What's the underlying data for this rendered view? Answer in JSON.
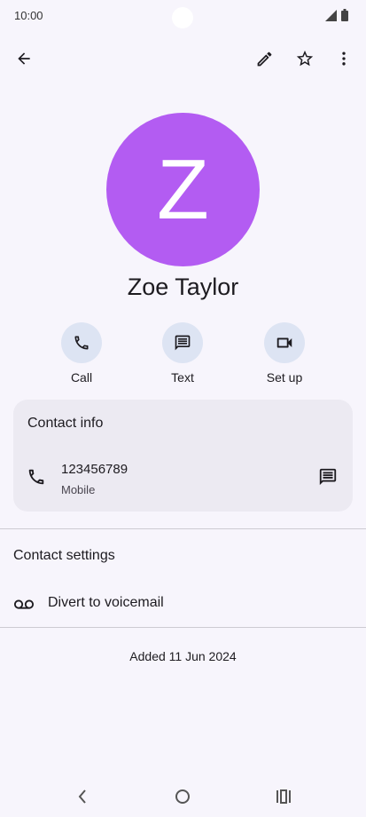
{
  "status_bar": {
    "time": "10:00"
  },
  "contact": {
    "initial": "Z",
    "name": "Zoe Taylor",
    "avatar_color": "#b35cf2"
  },
  "actions": [
    {
      "label": "Call",
      "icon": "phone-icon"
    },
    {
      "label": "Text",
      "icon": "message-icon"
    },
    {
      "label": "Set up",
      "icon": "video-icon"
    }
  ],
  "contact_info": {
    "title": "Contact info",
    "phone": {
      "number": "123456789",
      "type": "Mobile"
    }
  },
  "contact_settings": {
    "title": "Contact settings",
    "voicemail_label": "Divert to voicemail"
  },
  "added": "Added 11 Jun 2024",
  "colors": {
    "background": "#f7f5fc",
    "action_bg": "#dde4f3",
    "card_bg": "#eceaf2"
  }
}
